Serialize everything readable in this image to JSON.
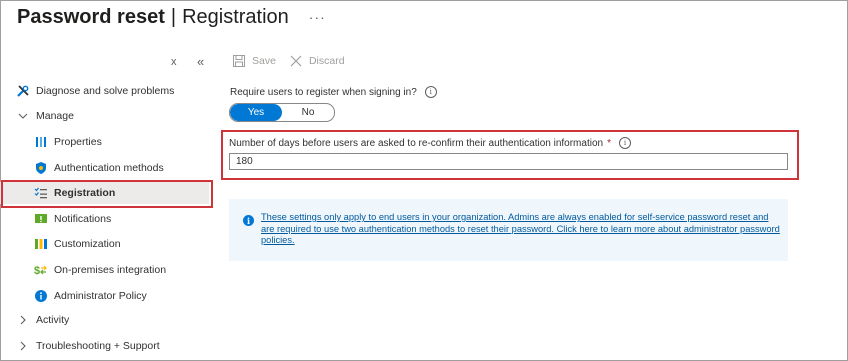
{
  "header": {
    "title_main": "Password reset",
    "title_sep": "|",
    "title_sub": "Registration",
    "more": "···"
  },
  "sidebar": {
    "close_glyph": "x",
    "collapse_glyph": "«",
    "items": [
      {
        "label": "Diagnose and solve problems",
        "icon": "wrench-icon"
      },
      {
        "label": "Manage",
        "icon": "chevron-down-icon"
      },
      {
        "label": "Properties",
        "icon": "properties-icon"
      },
      {
        "label": "Authentication methods",
        "icon": "shield-icon"
      },
      {
        "label": "Registration",
        "icon": "checklist-icon",
        "selected": true
      },
      {
        "label": "Notifications",
        "icon": "notification-icon"
      },
      {
        "label": "Customization",
        "icon": "customization-icon"
      },
      {
        "label": "On-premises integration",
        "icon": "sync-icon"
      },
      {
        "label": "Administrator Policy",
        "icon": "info-icon"
      },
      {
        "label": "Activity",
        "icon": "chevron-right-icon"
      },
      {
        "label": "Troubleshooting + Support",
        "icon": "chevron-right-icon"
      }
    ]
  },
  "toolbar": {
    "save_label": "Save",
    "discard_label": "Discard"
  },
  "form": {
    "require_label": "Require users to register when signing in?",
    "toggle_yes": "Yes",
    "toggle_no": "No",
    "toggle_selected": "Yes",
    "days_label": "Number of days before users are asked to re-confirm their authentication information",
    "days_required": "*",
    "days_value": "180"
  },
  "info": {
    "text": "These settings only apply to end users in your organization. Admins are always enabled for self-service password reset and are required to use two authentication methods to reset their password. Click here to learn more about administrator password policies."
  },
  "colors": {
    "accent": "#0078d4",
    "highlight": "#d13438",
    "info_bg": "#eff6fc"
  }
}
